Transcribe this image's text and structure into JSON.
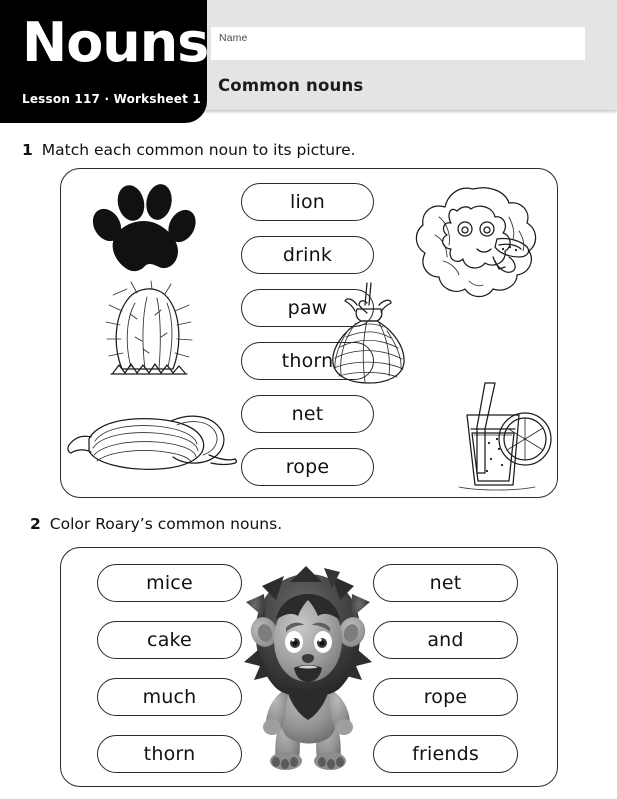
{
  "header": {
    "title": "Nouns",
    "subtitle": "Lesson 117 · Worksheet 1",
    "name_label": "Name",
    "name_value": "",
    "section_title": "Common nouns"
  },
  "exercises": [
    {
      "number": "1",
      "instruction": "Match each common noun to its picture.",
      "words": [
        "lion",
        "drink",
        "paw",
        "thorn",
        "net",
        "rope"
      ],
      "pictures_left": [
        "paw-print",
        "cactus-thorn",
        "rope-coil"
      ],
      "pictures_right": [
        "lion-head",
        "net-bag",
        "drink-glass"
      ]
    },
    {
      "number": "2",
      "instruction": "Color Roary’s common nouns.",
      "words_left": [
        "mice",
        "cake",
        "much",
        "thorn"
      ],
      "words_right": [
        "net",
        "and",
        "rope",
        "friends"
      ],
      "mascot": "roary-lion"
    }
  ],
  "colors": {
    "header_band": "#e3e4e4",
    "title_block": "#000000",
    "ink": "#1b1b1b",
    "paper": "#ffffff"
  }
}
